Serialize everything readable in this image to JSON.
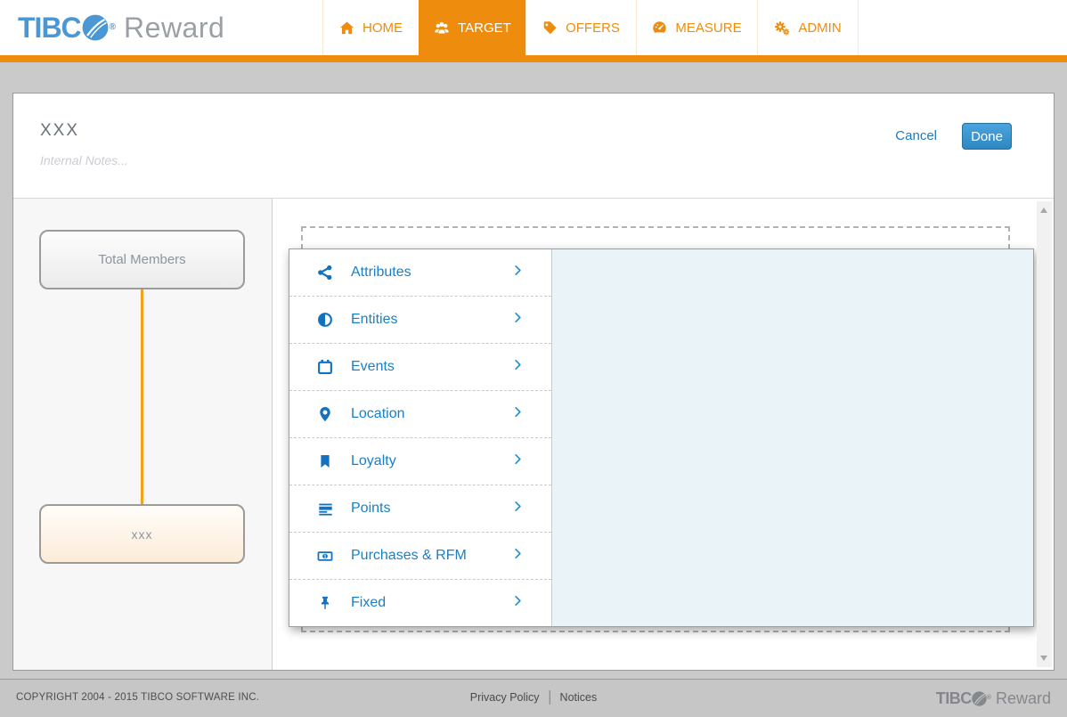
{
  "brand": {
    "logo_text": "TIBC",
    "logo_reg": "®",
    "logo_product": "Reward"
  },
  "nav": {
    "items": [
      {
        "label": "HOME",
        "icon": "home-icon",
        "active": false
      },
      {
        "label": "TARGET",
        "icon": "users-icon",
        "active": true
      },
      {
        "label": "OFFERS",
        "icon": "tag-icon",
        "active": false
      },
      {
        "label": "MEASURE",
        "icon": "gauge-icon",
        "active": false
      },
      {
        "label": "ADMIN",
        "icon": "gears-icon",
        "active": false
      }
    ]
  },
  "toolbar": {
    "title": "XXX",
    "notes_placeholder": "Internal Notes...",
    "cancel_label": "Cancel",
    "done_label": "Done"
  },
  "tree": {
    "root_label": "Total Members",
    "child_label": "xxx"
  },
  "menu": {
    "items": [
      {
        "label": "Attributes",
        "icon": "share-icon"
      },
      {
        "label": "Entities",
        "icon": "adjust-icon"
      },
      {
        "label": "Events",
        "icon": "calendar-icon"
      },
      {
        "label": "Location",
        "icon": "map-marker-icon"
      },
      {
        "label": "Loyalty",
        "icon": "bookmark-icon"
      },
      {
        "label": "Points",
        "icon": "bars-icon"
      },
      {
        "label": "Purchases & RFM",
        "icon": "money-icon"
      },
      {
        "label": "Fixed",
        "icon": "thumbtack-icon"
      }
    ]
  },
  "footer": {
    "copyright": "COPYRIGHT 2004 - 2015 TIBCO SOFTWARE INC.",
    "links": [
      "Privacy Policy",
      "Notices"
    ],
    "logo_text": "TIBC",
    "logo_reg": "®",
    "logo_product": "Reward"
  },
  "colors": {
    "accent_orange": "#ee8c0e",
    "connector_orange": "#f6a01e",
    "link_blue": "#1b7fc4",
    "button_blue": "#2f87c2",
    "logo_blue": "#4a97d3",
    "preview_pane_blue": "#e9f3f8",
    "page_background": "#cacaca"
  }
}
